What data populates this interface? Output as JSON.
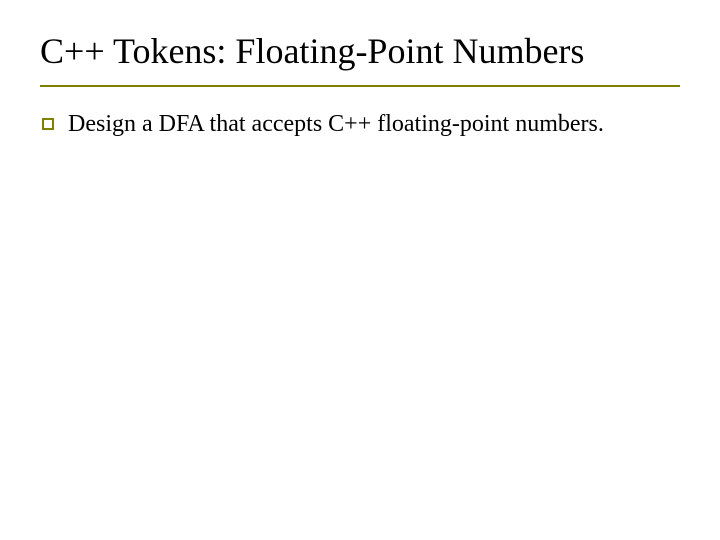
{
  "slide": {
    "title": "C++ Tokens: Floating-Point Numbers",
    "bullets": [
      {
        "text": "Design a DFA that accepts C++ floating-point numbers."
      }
    ]
  },
  "colors": {
    "accent": "#808000"
  }
}
